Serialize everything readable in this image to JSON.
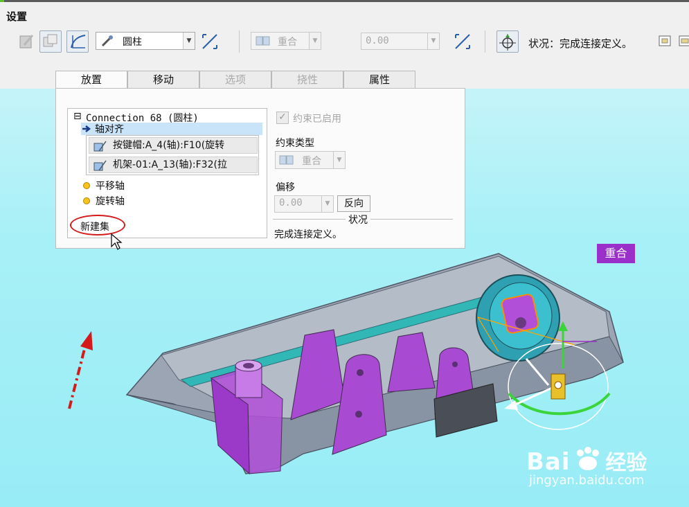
{
  "header": {
    "title": "设置"
  },
  "toolbar": {
    "joint_type": "圆柱",
    "constraint_combo": "重合",
    "offset_value": "0.00",
    "status_label": "状况：完成连接定义。"
  },
  "tabs": [
    {
      "label": "放置",
      "state": "active"
    },
    {
      "label": "移动",
      "state": "normal"
    },
    {
      "label": "选项",
      "state": "disabled"
    },
    {
      "label": "挠性",
      "state": "disabled"
    },
    {
      "label": "属性",
      "state": "normal"
    }
  ],
  "tree": {
    "collapse_glyph": "⊟",
    "root": "Connection_68 (圆柱)",
    "selected": "轴对齐",
    "references": [
      "按键帽:A_4(轴):F10(旋转",
      "机架-01:A_13(轴):F32(拉"
    ],
    "items": [
      "平移轴",
      "旋转轴"
    ],
    "new_set": "新建集"
  },
  "constraint": {
    "enabled_label": "约束已启用",
    "enabled": true,
    "type_label": "约束类型",
    "type_value": "重合",
    "offset_label": "偏移",
    "offset_value": "0.00",
    "flip_button": "反向",
    "status_title": "状况",
    "status_text": "完成连接定义。"
  },
  "viewport": {
    "tag_label": "重合",
    "tag_color": "#9b2fc9"
  },
  "watermark": {
    "brand": "Bai",
    "brand_cn": "经验",
    "url": "jingyan.baidu.com"
  },
  "colors": {
    "annotation_red": "#d41a1a",
    "model_gray": "#8c96a6",
    "part_purple": "#b04bd6",
    "wheel_teal": "#2aa0b0"
  }
}
